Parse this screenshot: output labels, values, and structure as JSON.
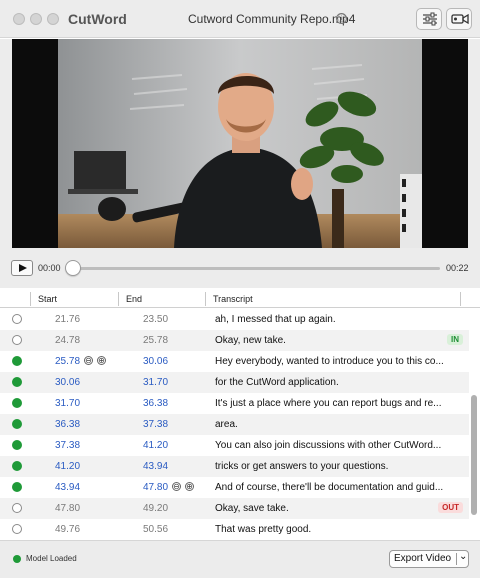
{
  "window": {
    "app_name": "CutWord",
    "document_title": "Cutword Community Repo.mp4",
    "info_icon": "ⓘ"
  },
  "player": {
    "current_time": "00:00",
    "total_time": "00:22",
    "progress": 0
  },
  "table": {
    "columns": [
      "Start",
      "End",
      "Transcript"
    ],
    "rows": [
      {
        "active": false,
        "start": "21.76",
        "end": "23.50",
        "text": "ah, I messed that up again.",
        "badge": ""
      },
      {
        "active": false,
        "start": "24.78",
        "end": "25.78",
        "text": "Okay, new take.",
        "badge": "IN"
      },
      {
        "active": true,
        "start": "25.78",
        "end": "30.06",
        "text": "Hey everybody, wanted to introduce you to this co...",
        "badge": "",
        "adjust_start": true
      },
      {
        "active": true,
        "start": "30.06",
        "end": "31.70",
        "text": "for the CutWord application.",
        "badge": ""
      },
      {
        "active": true,
        "start": "31.70",
        "end": "36.38",
        "text": "It's just a place where you can report bugs and re...",
        "badge": ""
      },
      {
        "active": true,
        "start": "36.38",
        "end": "37.38",
        "text": "area.",
        "badge": ""
      },
      {
        "active": true,
        "start": "37.38",
        "end": "41.20",
        "text": "You can also join discussions with other CutWord...",
        "badge": ""
      },
      {
        "active": true,
        "start": "41.20",
        "end": "43.94",
        "text": "tricks or get answers to your questions.",
        "badge": ""
      },
      {
        "active": true,
        "start": "43.94",
        "end": "47.80",
        "text": "And of course, there'll be documentation and guid...",
        "badge": "",
        "adjust_end": true
      },
      {
        "active": false,
        "start": "47.80",
        "end": "49.20",
        "text": "Okay, save take.",
        "badge": "OUT"
      },
      {
        "active": false,
        "start": "49.76",
        "end": "50.56",
        "text": "That was pretty good.",
        "badge": ""
      }
    ],
    "adjust_minus": "⊖",
    "adjust_plus": "⊕"
  },
  "footer": {
    "status": "Model Loaded",
    "export_label": "Export Video",
    "export_chevron": "⌄"
  },
  "colors": {
    "active_dot": "#1f9a38",
    "active_time": "#2a5bc2",
    "inactive_time": "#7a7a7a",
    "in_badge": "#1f8f35",
    "out_badge": "#c62828"
  },
  "icons": {
    "settings": "sliders-icon",
    "camera": "video-camera-icon",
    "play": "play-icon"
  }
}
